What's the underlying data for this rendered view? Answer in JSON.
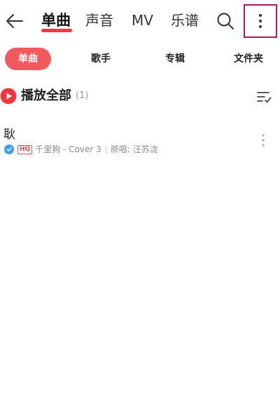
{
  "nav": {
    "tabs": [
      {
        "label": "单曲",
        "active": true
      },
      {
        "label": "声音",
        "active": false
      },
      {
        "label": "MV",
        "active": false
      },
      {
        "label": "乐谱",
        "active": false
      }
    ],
    "icons": {
      "back": "arrow-left-icon",
      "search": "search-icon",
      "more": "more-vertical-icon"
    }
  },
  "filters": [
    {
      "label": "单曲",
      "active": true
    },
    {
      "label": "歌手",
      "active": false
    },
    {
      "label": "专辑",
      "active": false
    },
    {
      "label": "文件夹",
      "active": false
    }
  ],
  "play_all": {
    "label": "播放全部",
    "count": "(1)"
  },
  "songs": [
    {
      "title": "耿",
      "quality_badge": "HQ",
      "artist": "千里狗 - Cover 3",
      "original": "原唱: 汪苏泷"
    }
  ],
  "colors": {
    "accent": "#f0383f",
    "chip_active": "#f25a5f",
    "verified": "#3d9df2",
    "highlight_box": "#b5164c"
  }
}
